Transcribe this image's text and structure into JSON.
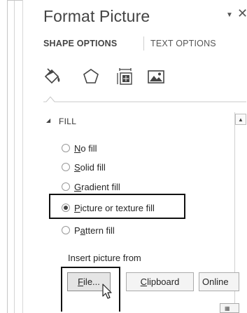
{
  "pane": {
    "title": "Format Picture",
    "dropdown_icon": "▼",
    "close_icon": "✕"
  },
  "tabs": [
    {
      "label": "SHAPE OPTIONS",
      "selected": true
    },
    {
      "label": "TEXT OPTIONS",
      "selected": false
    }
  ],
  "icon_tabs": [
    {
      "name": "fill-line-icon"
    },
    {
      "name": "effects-icon"
    },
    {
      "name": "size-properties-icon"
    },
    {
      "name": "picture-icon"
    }
  ],
  "fill_section": {
    "label": "FILL",
    "expand_icon": "◢",
    "options": [
      {
        "accesskey": "N",
        "rest": "o fill",
        "checked": false
      },
      {
        "accesskey": "S",
        "rest": "olid fill",
        "checked": false
      },
      {
        "accesskey": "G",
        "rest": "radient fill",
        "checked": false
      },
      {
        "accesskey": "P",
        "rest": "icture or texture fill",
        "checked": true
      },
      {
        "prefix": "P",
        "accesskey": "a",
        "rest": "ttern fill",
        "checked": false
      }
    ]
  },
  "insert_picture": {
    "label": "Insert picture from",
    "file_button": {
      "accesskey": "F",
      "rest": "ile..."
    },
    "clipboard_button": {
      "accesskey": "C",
      "rest": "lipboard"
    },
    "online_button": "Online"
  },
  "scrollbar": {
    "up_icon": "▲"
  },
  "colors": {
    "highlight": "#111111",
    "text": "#262626"
  }
}
